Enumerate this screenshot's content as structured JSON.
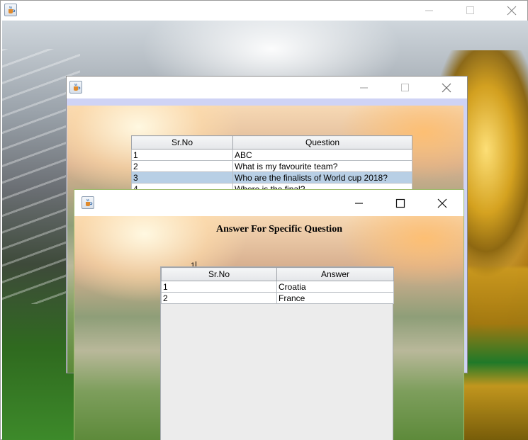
{
  "main_window": {
    "title": ""
  },
  "questions_window": {
    "title": "",
    "table": {
      "columns": [
        "Sr.No",
        "Question"
      ],
      "rows": [
        {
          "sr": "1",
          "question": "ABC"
        },
        {
          "sr": "2",
          "question": "What is my favourite team?"
        },
        {
          "sr": "3",
          "question": "Who are the finalists of World cup 2018?",
          "selected": true
        },
        {
          "sr": "4",
          "question": "Where is the final?"
        }
      ]
    }
  },
  "answer_window": {
    "title": "",
    "heading": "Answer For Specific Question",
    "field_value": "1",
    "table": {
      "columns": [
        "Sr.No",
        "Answer"
      ],
      "rows": [
        {
          "sr": "1",
          "answer": "Croatia"
        },
        {
          "sr": "2",
          "answer": "France"
        }
      ]
    }
  },
  "icons": [
    "java-cup-icon",
    "minimize-icon",
    "maximize-icon",
    "close-icon"
  ],
  "colors": {
    "selection": "#b8cfe5",
    "window_border_gray": "#9a9a9a",
    "window_border_green": "#9dbb6a"
  }
}
